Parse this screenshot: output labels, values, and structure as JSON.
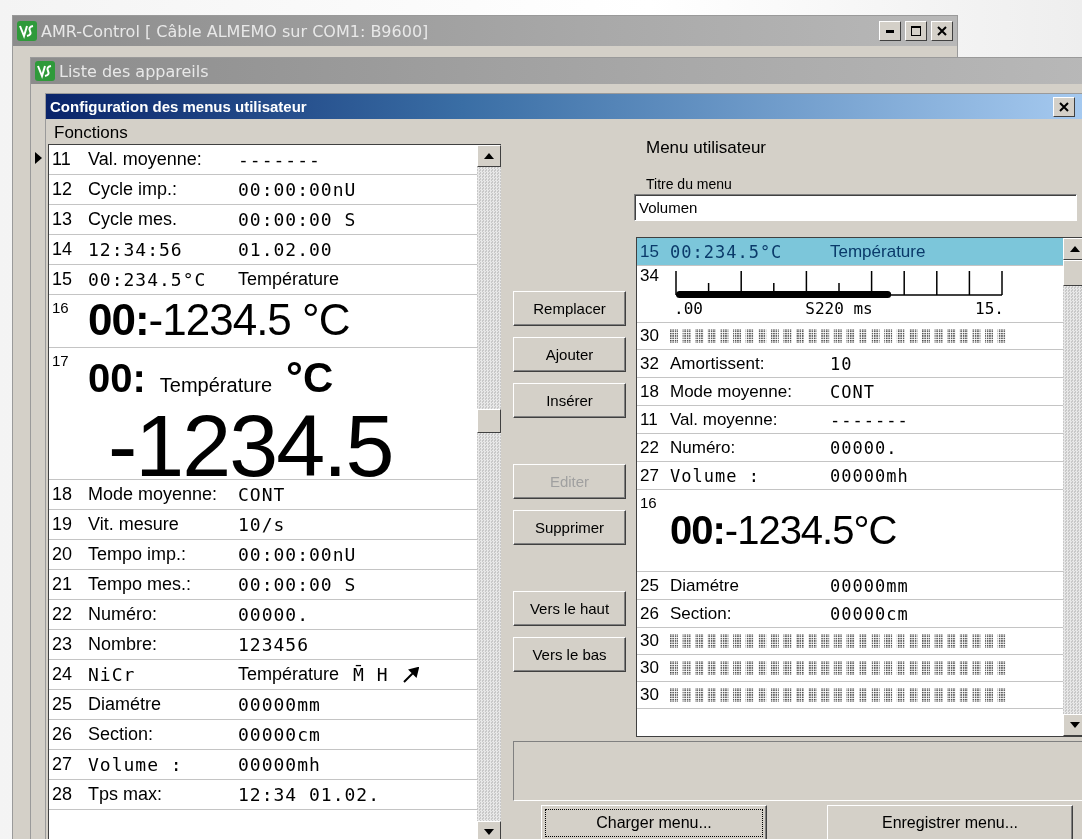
{
  "app_window": {
    "title": "AMR-Control [ Câble ALMEMO sur COM1: B9600]"
  },
  "child_window": {
    "title": "Liste des appareils"
  },
  "dialog": {
    "title": "Configuration des menus utilisateur",
    "functions": {
      "label": "Fonctions",
      "rows": [
        {
          "number": "11",
          "kind": "text",
          "selected": false,
          "cells": [
            {
              "text": "Val. moyenne:",
              "mono": false
            },
            {
              "text": "-------",
              "mono": true
            }
          ]
        },
        {
          "number": "12",
          "kind": "text",
          "selected": false,
          "cells": [
            {
              "text": "Cycle imp.:",
              "mono": false
            },
            {
              "text": "00:00:00nU",
              "mono": true
            }
          ]
        },
        {
          "number": "13",
          "kind": "text",
          "selected": false,
          "cells": [
            {
              "text": "Cycle mes.",
              "mono": false
            },
            {
              "text": "00:00:00 S",
              "mono": true
            }
          ]
        },
        {
          "number": "14",
          "kind": "text",
          "selected": false,
          "cells": [
            {
              "text": "12:34:56",
              "mono": true
            },
            {
              "text": "01.02.00",
              "mono": true
            }
          ]
        },
        {
          "number": "15",
          "kind": "text",
          "selected": false,
          "cells": [
            {
              "text": "00:234.5°C",
              "mono": true
            },
            {
              "text": "Température",
              "mono": false
            }
          ]
        },
        {
          "number": "16",
          "kind": "big",
          "selected": false,
          "text": "**00:**-1234.5 °C"
        },
        {
          "number": "17",
          "kind": "large",
          "selected": false,
          "head": "00:",
          "caption": "Température",
          "unit": "°C",
          "value": "-1234.5"
        },
        {
          "number": "18",
          "kind": "text",
          "selected": false,
          "cells": [
            {
              "text": "Mode moyenne:",
              "mono": false
            },
            {
              "text": "CONT",
              "mono": true
            }
          ]
        },
        {
          "number": "19",
          "kind": "text",
          "selected": false,
          "cells": [
            {
              "text": "Vit. mesure",
              "mono": false
            },
            {
              "text": "10/s",
              "mono": true
            }
          ]
        },
        {
          "number": "20",
          "kind": "text",
          "selected": false,
          "cells": [
            {
              "text": "Tempo imp.:",
              "mono": false
            },
            {
              "text": "00:00:00nU",
              "mono": true
            }
          ]
        },
        {
          "number": "21",
          "kind": "text",
          "selected": false,
          "cells": [
            {
              "text": "Tempo mes.:",
              "mono": false
            },
            {
              "text": "00:00:00 S",
              "mono": true
            }
          ]
        },
        {
          "number": "22",
          "kind": "text",
          "selected": false,
          "cells": [
            {
              "text": "Numéro:",
              "mono": false
            },
            {
              "text": "00000.",
              "mono": true
            }
          ]
        },
        {
          "number": "23",
          "kind": "text",
          "selected": false,
          "cells": [
            {
              "text": "Nombre:",
              "mono": false
            },
            {
              "text": "123456",
              "mono": true
            }
          ]
        },
        {
          "number": "24",
          "kind": "sensor",
          "selected": false,
          "cells": [
            {
              "text": "NiCr",
              "mono": true
            },
            {
              "text": "Température",
              "mono": false
            },
            {
              "text": "M̄ H",
              "mono": true
            }
          ]
        },
        {
          "number": "25",
          "kind": "text",
          "selected": false,
          "cells": [
            {
              "text": "Diamétre",
              "mono": false
            },
            {
              "text": "00000mm",
              "mono": true
            }
          ]
        },
        {
          "number": "26",
          "kind": "text",
          "selected": false,
          "cells": [
            {
              "text": "Section:",
              "mono": false
            },
            {
              "text": "00000cm",
              "mono": true
            }
          ]
        },
        {
          "number": "27",
          "kind": "text",
          "selected": false,
          "cells": [
            {
              "text": "Volume :",
              "mono": true
            },
            {
              "text": "00000mh",
              "mono": true
            }
          ]
        },
        {
          "number": "28",
          "kind": "text",
          "selected": false,
          "cells": [
            {
              "text": "Tps max:",
              "mono": false
            },
            {
              "text": "12:34 01.02.",
              "mono": true
            }
          ]
        }
      ]
    },
    "actions": [
      {
        "buttons": [
          {
            "label": "Remplacer",
            "disabled": false
          },
          {
            "label": "Ajouter",
            "disabled": false
          },
          {
            "label": "Insérer",
            "disabled": false
          }
        ]
      },
      {
        "buttons": [
          {
            "label": "Editer",
            "disabled": true
          },
          {
            "label": "Supprimer",
            "disabled": false
          }
        ]
      },
      {
        "buttons": [
          {
            "label": "Vers le haut",
            "disabled": false
          },
          {
            "label": "Vers le bas",
            "disabled": false
          }
        ]
      }
    ],
    "user_menu": {
      "label": "Menu utilisateur",
      "title_label": "Titre du menu",
      "title_value": "Volumen",
      "rows": [
        {
          "number": "15",
          "kind": "text",
          "selected": true,
          "cells": [
            {
              "text": "00:234.5°C",
              "mono": true
            },
            {
              "text": "Température",
              "mono": false
            }
          ]
        },
        {
          "number": "34",
          "kind": "bar",
          "selected": false,
          "level": 0.66,
          "scale": [
            ".00",
            "S220 ms",
            "15."
          ]
        },
        {
          "number": "30",
          "kind": "dots",
          "selected": false
        },
        {
          "number": "32",
          "kind": "text",
          "selected": false,
          "cells": [
            {
              "text": "Amortissent:",
              "mono": false
            },
            {
              "text": "10",
              "mono": true
            }
          ]
        },
        {
          "number": "18",
          "kind": "text",
          "selected": false,
          "cells": [
            {
              "text": "Mode moyenne:",
              "mono": false
            },
            {
              "text": "CONT",
              "mono": true
            }
          ]
        },
        {
          "number": "11",
          "kind": "text",
          "selected": false,
          "cells": [
            {
              "text": "Val. moyenne:",
              "mono": false
            },
            {
              "text": "-------",
              "mono": true
            }
          ]
        },
        {
          "number": "22",
          "kind": "text",
          "selected": false,
          "cells": [
            {
              "text": "Numéro:",
              "mono": false
            },
            {
              "text": "00000.",
              "mono": true
            }
          ]
        },
        {
          "number": "27",
          "kind": "text",
          "selected": false,
          "cells": [
            {
              "text": "Volume :",
              "mono": true
            },
            {
              "text": "00000mh",
              "mono": true
            }
          ]
        },
        {
          "number": "16",
          "kind": "big",
          "selected": false,
          "text": "**00:**-1234.5°C"
        },
        {
          "number": "25",
          "kind": "text",
          "selected": false,
          "cells": [
            {
              "text": "Diamétre",
              "mono": false
            },
            {
              "text": "00000mm",
              "mono": true
            }
          ]
        },
        {
          "number": "26",
          "kind": "text",
          "selected": false,
          "cells": [
            {
              "text": "Section:",
              "mono": false
            },
            {
              "text": "00000cm",
              "mono": true
            }
          ]
        },
        {
          "number": "30",
          "kind": "dots",
          "selected": false
        },
        {
          "number": "30",
          "kind": "dots",
          "selected": false
        },
        {
          "number": "30",
          "kind": "dots",
          "selected": false
        }
      ]
    },
    "footer_buttons": [
      {
        "label": "Charger menu...",
        "focused": true
      },
      {
        "label": "Enregistrer menu...",
        "focused": false
      }
    ]
  }
}
